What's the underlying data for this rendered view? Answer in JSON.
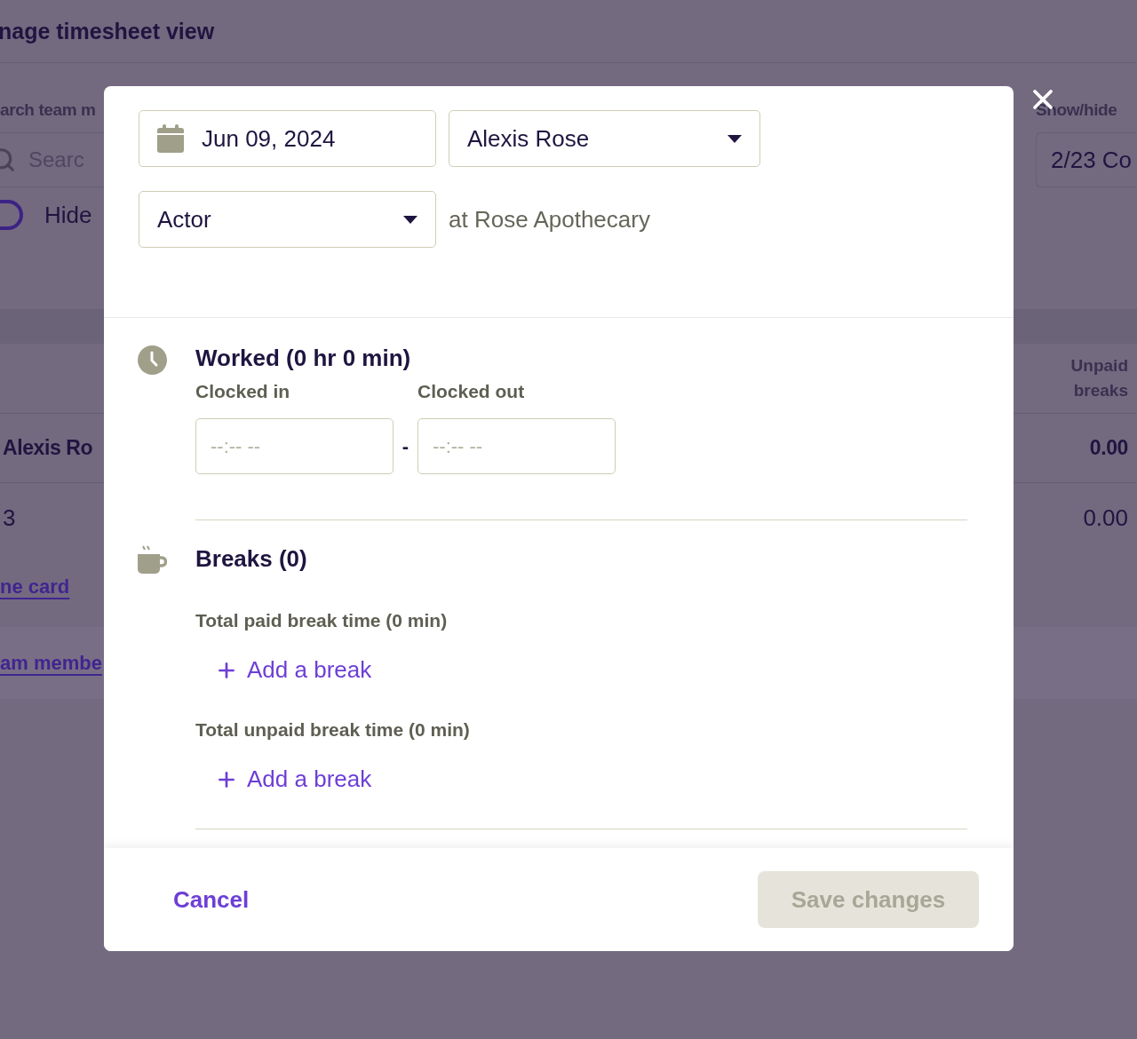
{
  "background": {
    "title": "nage timesheet view",
    "search_label": "arch team m",
    "search": {
      "placeholder": "Searc"
    },
    "hide_toggle": {
      "label": "Hide",
      "on": false
    },
    "show_hide": {
      "label": "Show/hide",
      "value": "2/23 Co"
    },
    "column_header": "Unpaid breaks",
    "rows": [
      {
        "name": "Alexis Ro",
        "unpaid_breaks": "0.00",
        "bold": true
      },
      {
        "name": "3",
        "unpaid_breaks": "0.00",
        "bold": false
      }
    ],
    "card_link": "ne card",
    "member_link": "am membe"
  },
  "modal": {
    "date": "Jun 09, 2024",
    "employee": "Alexis Rose",
    "role": "Actor",
    "location": "at Rose Apothecary",
    "worked": {
      "title": "Worked (0 hr 0 min)",
      "separator": "-",
      "fields": [
        {
          "label": "Clocked in",
          "placeholder": "--:-- --"
        },
        {
          "label": "Clocked out",
          "placeholder": "--:-- --"
        }
      ]
    },
    "breaks": {
      "title": "Breaks (0)",
      "groups": [
        {
          "label": "Total paid break time (0 min)",
          "action": "Add a break"
        },
        {
          "label": "Total unpaid break time (0 min)",
          "action": "Add a break"
        }
      ]
    },
    "cancel": "Cancel",
    "save": {
      "label": "Save changes",
      "disabled": true
    }
  }
}
